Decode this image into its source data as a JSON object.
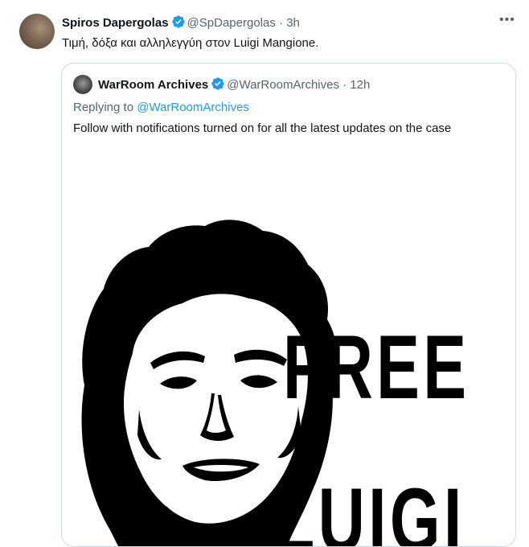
{
  "post": {
    "author_name": "Spiros Dapergolas",
    "handle": "@SpDapergolas",
    "separator": "·",
    "time": "3h",
    "text": "Τιμή, δόξα και αλληλεγγύη στον Luigi Mangione.",
    "more_icon": "more-horizontal-icon",
    "more_glyph": "•••"
  },
  "quote": {
    "author_name": "WarRoom Archives",
    "handle": "@WarRoomArchives",
    "separator": "·",
    "time": "12h",
    "replying_prefix": "Replying to",
    "replying_to": "@WarRoomArchives",
    "text": "Follow with notifications turned on for all the latest updates on the case",
    "image": {
      "line1": "FREE",
      "line2": "LUIGI"
    }
  },
  "colors": {
    "verified_blue": "#1d9bf0",
    "muted_text": "#536471",
    "border": "#cfd9de"
  }
}
